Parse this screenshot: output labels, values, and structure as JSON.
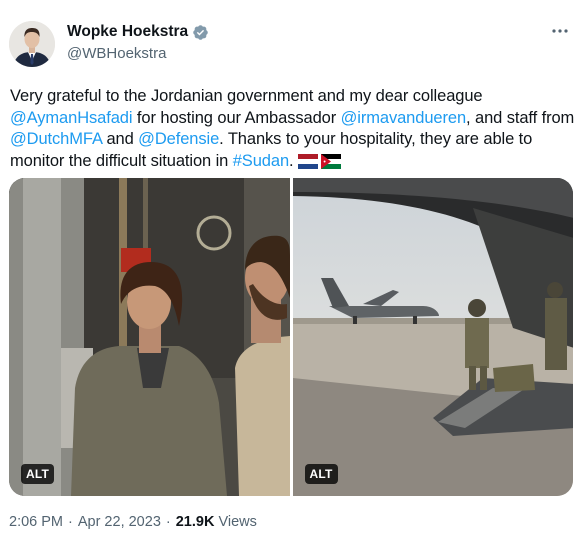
{
  "author": {
    "display_name": "Wopke Hoekstra",
    "handle": "@WBHoekstra",
    "verified": true
  },
  "tweet": {
    "text_1": "Very grateful to the Jordanian government and my dear colleague",
    "mention_1": "@AymanHsafadi",
    "text_2": " for hosting our Ambassador ",
    "mention_2": "@irmavandueren",
    "text_3": ", and staff from ",
    "mention_3": "@DutchMFA",
    "text_4": " and ",
    "mention_4": "@Defensie",
    "text_5": ". Thanks to your hospitality, they are able to monitor the difficult situation in ",
    "hashtag": "#Sudan",
    "text_6": ". ",
    "flags": [
      "netherlands-flag",
      "jordan-flag"
    ]
  },
  "media": {
    "alt_label_left": "ALT",
    "alt_label_right": "ALT"
  },
  "meta": {
    "time": "2:06 PM",
    "separator": "·",
    "date": "Apr 22, 2023",
    "separator2": "·",
    "views_count": "21.9K",
    "views_label": "Views"
  },
  "colors": {
    "link": "#1d9bf0",
    "verified": "#829aab",
    "secondary_text": "#536471"
  },
  "icons": [
    "verified-badge-icon",
    "more-options-icon"
  ]
}
